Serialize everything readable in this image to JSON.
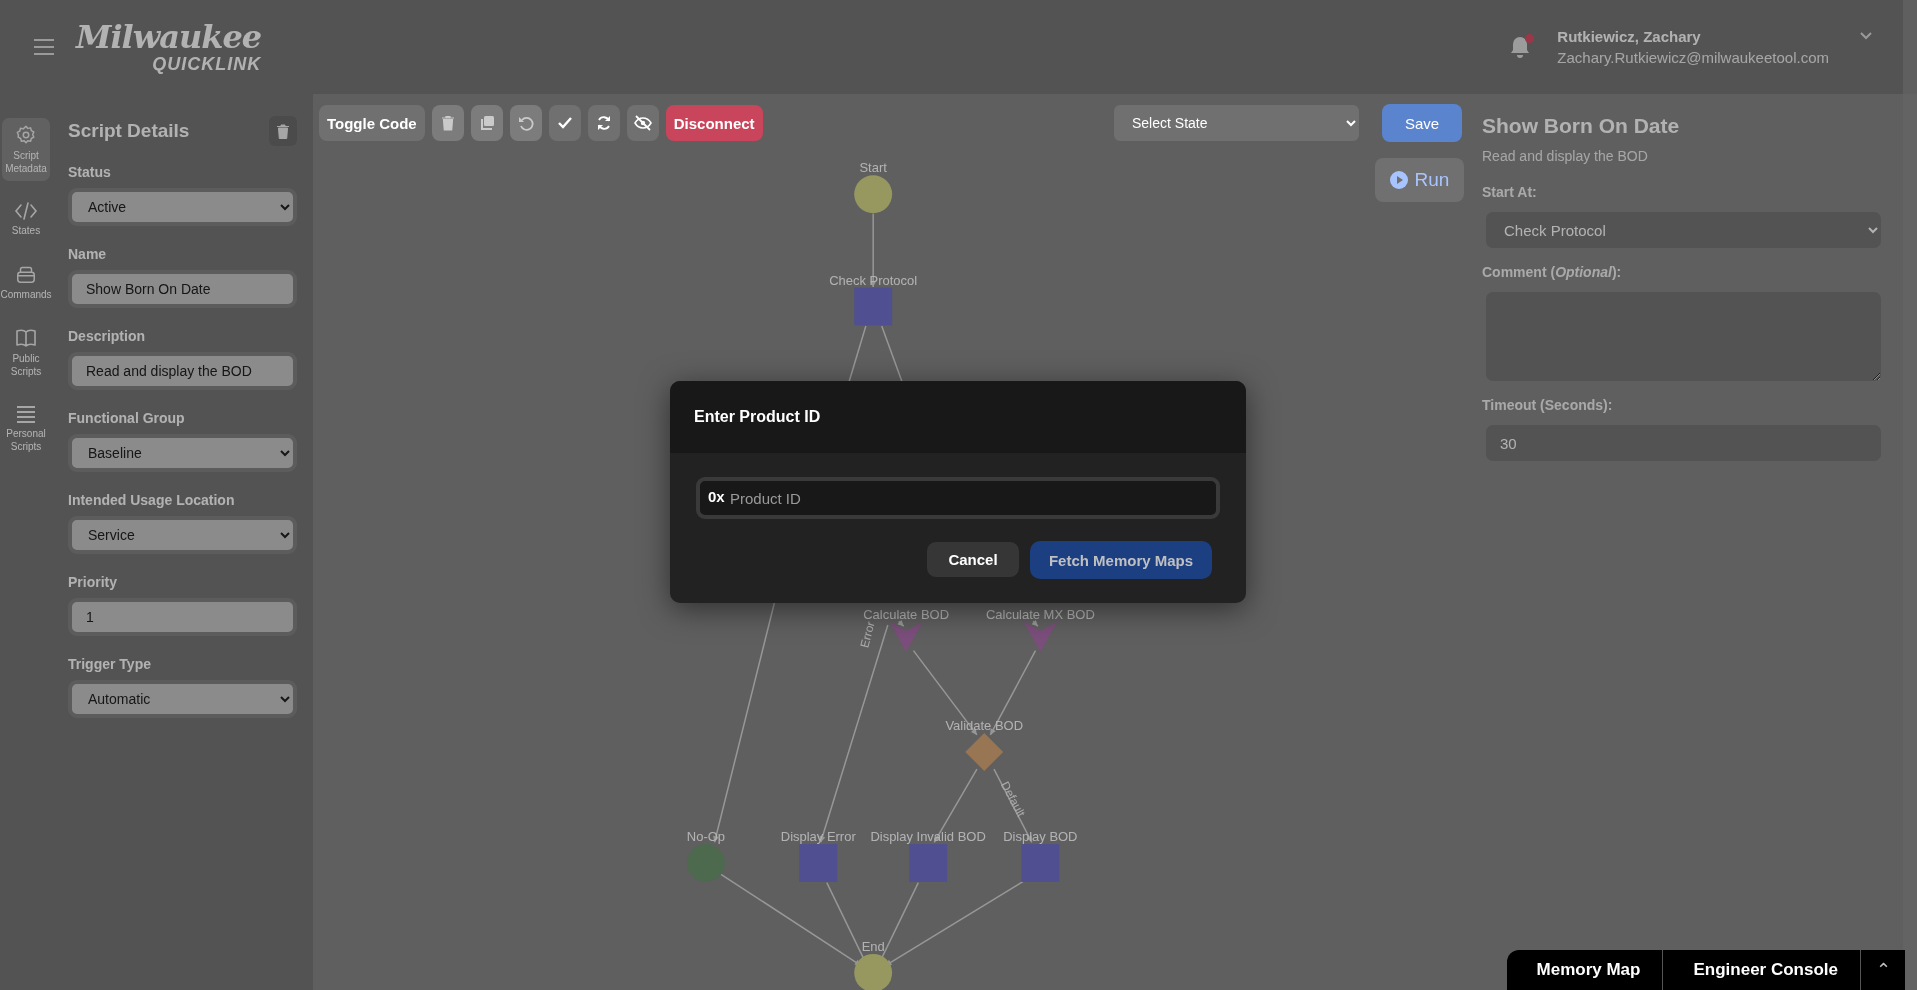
{
  "header": {
    "logo": {
      "brand": "Milwaukee",
      "product": "QUICKLINK"
    },
    "notifications": {
      "unread": true
    },
    "user": {
      "name": "Rutkiewicz, Zachary",
      "email": "Zachary.Rutkiewicz@milwaukeetool.com"
    }
  },
  "rail": [
    {
      "label": "Script Metadata",
      "selected": true
    },
    {
      "label": "States",
      "selected": false
    },
    {
      "label": "Commands",
      "selected": false
    },
    {
      "label": "Public Scripts",
      "selected": false
    },
    {
      "label": "Personal Scripts",
      "selected": false
    }
  ],
  "script_details": {
    "title": "Script Details",
    "fields": [
      {
        "label": "Status",
        "kind": "select",
        "value": "Active"
      },
      {
        "label": "Name",
        "kind": "text",
        "value": "Show Born On Date"
      },
      {
        "label": "Description",
        "kind": "text",
        "value": "Read and display the BOD"
      },
      {
        "label": "Functional Group",
        "kind": "select",
        "value": "Baseline"
      },
      {
        "label": "Intended Usage Location",
        "kind": "select",
        "value": "Service"
      },
      {
        "label": "Priority",
        "kind": "text",
        "value": "1"
      },
      {
        "label": "Trigger Type",
        "kind": "select",
        "value": "Automatic"
      }
    ]
  },
  "toolbar": {
    "toggle_code": "Toggle Code",
    "tools": [
      {
        "disabled": true
      },
      {
        "disabled": true
      },
      {
        "disabled": true
      },
      {
        "disabled": false
      },
      {
        "disabled": false
      },
      {
        "disabled": false
      }
    ],
    "disconnect": "Disconnect",
    "state_select": {
      "placeholder": "Select State"
    },
    "save": "Save",
    "run": "Run"
  },
  "flow": {
    "nodes": [
      {
        "label": "Start",
        "kind": "start"
      },
      {
        "label": "Check Protocol",
        "kind": "state"
      },
      {
        "label": "Calculate BOD",
        "kind": "calc"
      },
      {
        "label": "Calculate MX BOD",
        "kind": "calc"
      },
      {
        "label": "Validate BOD",
        "kind": "decision"
      },
      {
        "label": "No-Op",
        "kind": "noop"
      },
      {
        "label": "Display Error",
        "kind": "state"
      },
      {
        "label": "Display Invalid BOD",
        "kind": "state"
      },
      {
        "label": "Display BOD",
        "kind": "state"
      },
      {
        "label": "End",
        "kind": "end"
      }
    ],
    "edge_labels": [
      "Error",
      "Default"
    ]
  },
  "state_panel": {
    "title": "Show Born On Date",
    "subtitle": "Read and display the BOD",
    "start_at_label": "Start At:",
    "start_at": "Check Protocol",
    "comment_label": "Comment (*Optional*):",
    "timeout_label": "Timeout (Seconds):",
    "timeout": "30"
  },
  "modal": {
    "title": "Enter Product ID",
    "prefix": "0x",
    "placeholder": "Product ID",
    "cancel": "Cancel",
    "confirm": "Fetch Memory Maps"
  },
  "bottom_tabs": [
    {
      "label": "Memory Map"
    },
    {
      "label": "Engineer Console"
    }
  ],
  "bottom_expand": "⌃"
}
